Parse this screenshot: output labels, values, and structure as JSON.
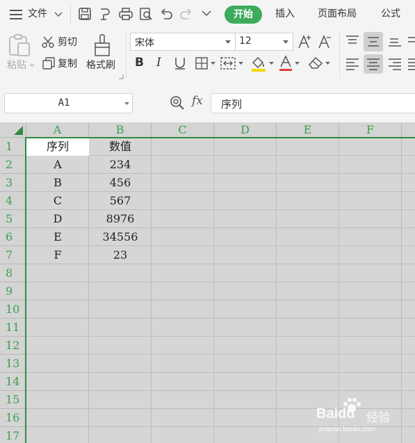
{
  "menubar": {
    "file_label": "文件",
    "tabs": [
      "开始",
      "插入",
      "页面布局",
      "公式"
    ]
  },
  "ribbon": {
    "paste_label": "粘贴",
    "cut_label": "剪切",
    "copy_label": "复制",
    "format_painter_label": "格式刷",
    "font_name": "宋体",
    "font_size": "12",
    "font_color": "#e33b3b",
    "fill_color": "#f5d800"
  },
  "formula_bar": {
    "cell_ref": "A1",
    "fx_label": "fx",
    "content": "序列"
  },
  "sheet": {
    "columns": [
      "A",
      "B",
      "C",
      "D",
      "E",
      "F"
    ],
    "rows": [
      "1",
      "2",
      "3",
      "4",
      "5",
      "6",
      "7",
      "8",
      "9",
      "10",
      "11",
      "12",
      "13",
      "14",
      "15",
      "16",
      "17"
    ],
    "headers": [
      "序列",
      "数值"
    ],
    "data": [
      [
        "A",
        "234"
      ],
      [
        "B",
        "456"
      ],
      [
        "C",
        "567"
      ],
      [
        "D",
        "8976"
      ],
      [
        "E",
        "34556"
      ],
      [
        "F",
        "23"
      ]
    ]
  },
  "watermark": {
    "brand": "Baidu",
    "cn": "经验",
    "url": "jingyan.baidu.com"
  },
  "accent_color": "#3cab5a"
}
